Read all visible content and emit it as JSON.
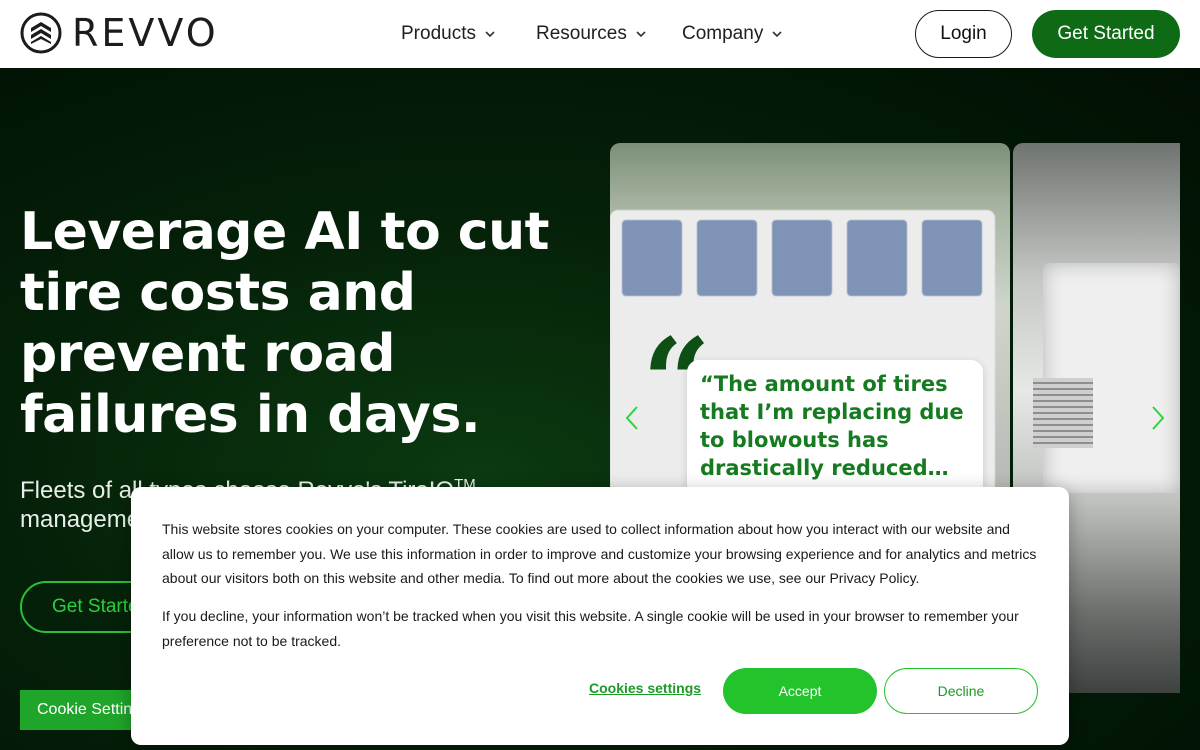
{
  "header": {
    "logo_text": "REVVO",
    "nav": [
      {
        "label": "Products"
      },
      {
        "label": "Resources"
      },
      {
        "label": "Company"
      }
    ],
    "login_label": "Login",
    "cta_label": "Get Started"
  },
  "hero": {
    "title": "Leverage AI to cut tire costs and prevent road failures in days.",
    "subtitle_visible": "Fleets of all types choose Revvo's TireIQ",
    "subtitle_sup": "TM",
    "subtitle_rest": "manageme… monitor, ar…",
    "cta_label": "Get Started",
    "cookie_settings_label": "Cookie Settings"
  },
  "slider": {
    "quote": "“The amount of tires that I’m replacing due to blowouts has drastically reduced…"
  },
  "cookie_banner": {
    "paragraph_1": "This website stores cookies on your computer. These cookies are used to collect information about how you interact with our website and allow us to remember you. We use this information in order to improve and customize your browsing experience and for analytics and metrics about our visitors both on this website and other media. To find out more about the cookies we use, see our Privacy Policy.",
    "paragraph_2": "If you decline, your information won’t be tracked when you visit this website. A single cookie will be used in your browser to remember your preference not to be tracked.",
    "settings_link": "Cookies settings",
    "accept_label": "Accept",
    "decline_label": "Decline"
  },
  "colors": {
    "brand_green": "#0f6a16",
    "accent_green": "#22c32b",
    "hero_bg": "#052109"
  },
  "icons": [
    "revvo-logo-icon",
    "chevron-down-icon",
    "arrow-left-icon",
    "arrow-right-icon",
    "quote-mark-icon"
  ]
}
